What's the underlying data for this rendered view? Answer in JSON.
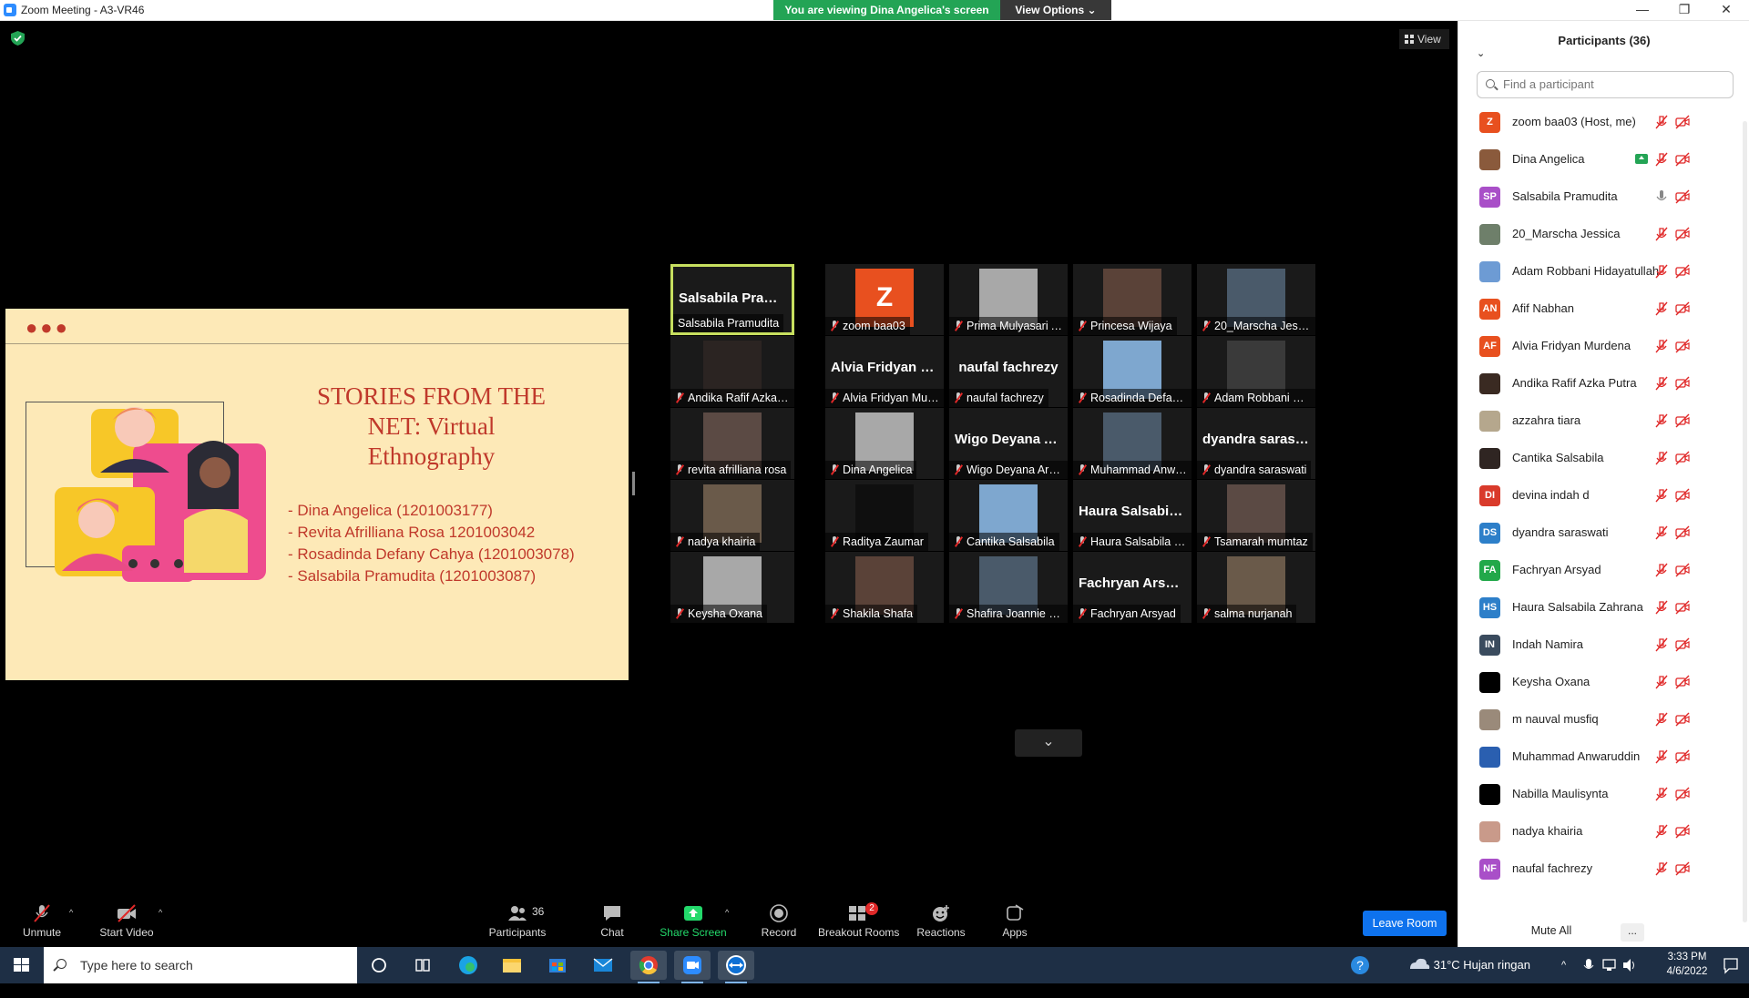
{
  "window": {
    "title": "Zoom Meeting - A3-VR46",
    "viewing_banner": "You are viewing Dina Angelica's screen",
    "view_options": "View Options"
  },
  "meeting": {
    "view_label": "View"
  },
  "slide": {
    "title": "STORIES FROM THE NET: Virtual Ethnography",
    "authors": [
      "- Dina Angelica (1201003177)",
      "- Revita Afrilliana Rosa 1201003042",
      "- Rosadinda Defany Cahya (1201003078)",
      "- Salsabila Pramudita (1201003087)"
    ]
  },
  "gallery": [
    {
      "name": "Salsabila Pramudita",
      "big": "Salsabila Pramu...",
      "active": true
    },
    {
      "name": "zoom baa03",
      "avatar_letter": "Z"
    },
    {
      "name": "Prima Mulyasari Agus..."
    },
    {
      "name": "Princesa Wijaya"
    },
    {
      "name": "20_Marscha Jessica"
    },
    {
      "name": "Andika Rafif Azka Putra"
    },
    {
      "name": "Alvia Fridyan Murdena",
      "big": "Alvia Fridyan M..."
    },
    {
      "name": "naufal fachrezy",
      "big": "naufal fachrezy"
    },
    {
      "name": "Rosadinda Defany Ca..."
    },
    {
      "name": "Adam Robbani Hiday..."
    },
    {
      "name": "revita afrilliana rosa"
    },
    {
      "name": "Dina Angelica"
    },
    {
      "name": "Wigo Deyana Artilla ...",
      "big": "Wigo Deyana Ar..."
    },
    {
      "name": "Muhammad Anwarud..."
    },
    {
      "name": "dyandra saraswati",
      "big": "dyandra saraswati"
    },
    {
      "name": "nadya khairia"
    },
    {
      "name": "Raditya Zaumar"
    },
    {
      "name": "Cantika Salsabila"
    },
    {
      "name": "Haura Salsabila Zahr...",
      "big": "Haura Salsabila..."
    },
    {
      "name": "Tsamarah mumtaz"
    },
    {
      "name": "Keysha Oxana"
    },
    {
      "name": "Shakila Shafa"
    },
    {
      "name": "Shafira Joannie Siregar"
    },
    {
      "name": "Fachryan Arsyad",
      "big": "Fachryan Arsyad"
    },
    {
      "name": "salma nurjanah"
    }
  ],
  "toolbar": {
    "unmute": "Unmute",
    "start_video": "Start Video",
    "participants": "Participants",
    "participants_count": "36",
    "chat": "Chat",
    "share_screen": "Share Screen",
    "record": "Record",
    "breakout_rooms": "Breakout Rooms",
    "breakout_badge": "2",
    "reactions": "Reactions",
    "apps": "Apps",
    "leave": "Leave Room"
  },
  "panel": {
    "title": "Participants (36)",
    "search_placeholder": "Find a participant",
    "mute_all": "Mute All",
    "more": "...",
    "participants": [
      {
        "initials": "Z",
        "name": "zoom baa03 (Host, me)",
        "color": "#e8501f"
      },
      {
        "initials": "",
        "name": "Dina Angelica",
        "color": "#8a5a3c",
        "sharing": true
      },
      {
        "initials": "SP",
        "name": "Salsabila Pramudita",
        "color": "#a94fc8",
        "mic_on": true
      },
      {
        "initials": "",
        "name": "20_Marscha Jessica",
        "color": "#6e7f6a"
      },
      {
        "initials": "",
        "name": "Adam Robbani Hidayatullah",
        "color": "#6d9bd4"
      },
      {
        "initials": "AN",
        "name": "Afif Nabhan",
        "color": "#e8501f"
      },
      {
        "initials": "AF",
        "name": "Alvia Fridyan Murdena",
        "color": "#e8501f"
      },
      {
        "initials": "",
        "name": "Andika Rafif Azka Putra",
        "color": "#3a2a22"
      },
      {
        "initials": "",
        "name": "azzahra tiara",
        "color": "#b5a78d"
      },
      {
        "initials": "",
        "name": "Cantika Salsabila",
        "color": "#2f2522"
      },
      {
        "initials": "DI",
        "name": "devina indah d",
        "color": "#d93a2b"
      },
      {
        "initials": "DS",
        "name": "dyandra saraswati",
        "color": "#2d7fc9"
      },
      {
        "initials": "FA",
        "name": "Fachryan Arsyad",
        "color": "#22a84a"
      },
      {
        "initials": "HS",
        "name": "Haura Salsabila Zahrana",
        "color": "#2d7fc9"
      },
      {
        "initials": "IN",
        "name": "Indah Namira",
        "color": "#3a4b5e"
      },
      {
        "initials": "",
        "name": "Keysha Oxana",
        "color": "#000000"
      },
      {
        "initials": "",
        "name": "m nauval musfiq",
        "color": "#9a8a7a"
      },
      {
        "initials": "",
        "name": "Muhammad Anwaruddin",
        "color": "#2a5fb0"
      },
      {
        "initials": "",
        "name": "Nabilla Maulisynta",
        "color": "#000000"
      },
      {
        "initials": "",
        "name": "nadya khairia",
        "color": "#c99a8a"
      },
      {
        "initials": "NF",
        "name": "naufal fachrezy",
        "color": "#a94fc8"
      }
    ]
  },
  "taskbar": {
    "search_placeholder": "Type here to search",
    "weather": "31°C  Hujan ringan",
    "time": "3:33 PM",
    "date": "4/6/2022"
  }
}
